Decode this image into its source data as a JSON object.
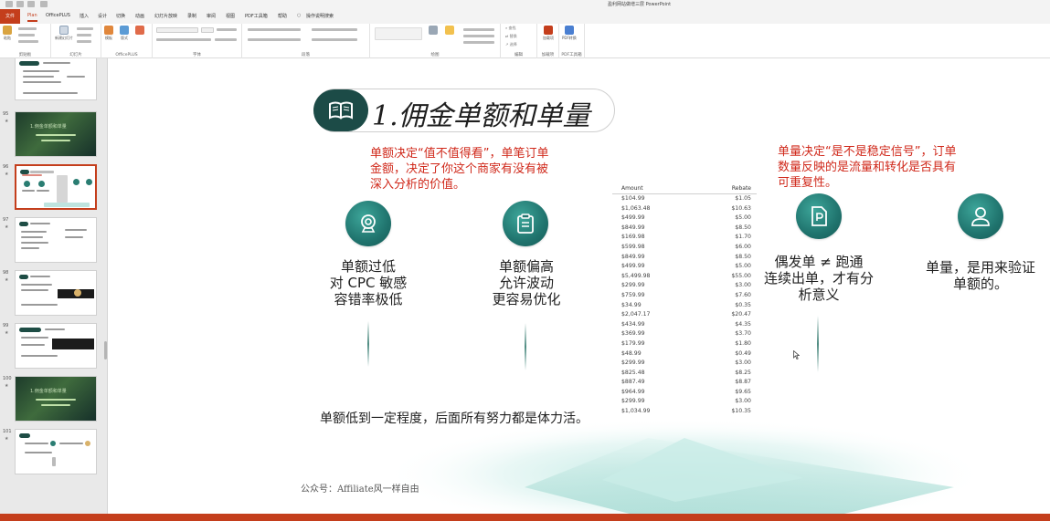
{
  "titlebar": {
    "document_title": "盈利网站做增三层    PowerPoint"
  },
  "ribbon": {
    "tabs": [
      {
        "label": "文件"
      },
      {
        "label": "Plan"
      },
      {
        "label": "OfficePLUS"
      },
      {
        "label": "插入"
      },
      {
        "label": "设计"
      },
      {
        "label": "切换"
      },
      {
        "label": "动画"
      },
      {
        "label": "幻灯片放映"
      },
      {
        "label": "录制"
      },
      {
        "label": "审阅"
      },
      {
        "label": "视图"
      },
      {
        "label": "PDF工具箱"
      },
      {
        "label": "帮助"
      },
      {
        "label": "操作说明搜索"
      }
    ],
    "groups": [
      {
        "label": "剪贴板"
      },
      {
        "label": "幻灯片"
      },
      {
        "label": "OfficePLUS"
      },
      {
        "label": "字体"
      },
      {
        "label": "段落"
      },
      {
        "label": "绘图"
      },
      {
        "label": "编辑"
      },
      {
        "label": "加载项"
      },
      {
        "label": "PDF工具箱"
      }
    ],
    "buttons": {
      "paste": "粘贴",
      "new_slide": "新建幻灯片",
      "template": "模板",
      "layout": "版式",
      "font_name": "",
      "find": "查找",
      "replace": "替换",
      "select": "选择",
      "addins": "加载项",
      "pdf_convert": "PDF转换"
    }
  },
  "thumbnails": [
    {
      "number": "",
      "starred": false
    },
    {
      "number": "95",
      "starred": true,
      "text": "1.佣金单额和单量"
    },
    {
      "number": "96",
      "starred": true,
      "selected": true
    },
    {
      "number": "97",
      "starred": true
    },
    {
      "number": "98",
      "starred": true
    },
    {
      "number": "99",
      "starred": true
    },
    {
      "number": "100",
      "starred": true,
      "text": "1.佣金单额和单量"
    },
    {
      "number": "101",
      "starred": true
    }
  ],
  "slide": {
    "title": "1.佣金单额和单量",
    "left_note": [
      "单额决定“值不值得看”，单笔订单",
      "金额，决定了你这个商家有没有被",
      "深入分析的价值。"
    ],
    "right_note": [
      "单量决定“是不是稳定信号”，订单",
      "数量反映的是流量和转化是否具有",
      "可重复性。"
    ],
    "col1": [
      "单额过低",
      "对 CPC 敏感",
      "容错率极低"
    ],
    "col2": [
      "单额偏高",
      "允许波动",
      "更容易优化"
    ],
    "col3": [
      "偶发单 ≠ 跑通",
      "连续出单，才有分",
      "析意义"
    ],
    "col4": [
      "单量，是用来验证",
      "单额的。"
    ],
    "bottom_text": "单额低到一定程度，后面所有努力都是体力活。",
    "footer": "公众号：Affiliate风一样自由",
    "icons": [
      "webcam-icon",
      "clipboard-icon",
      "document-p-icon",
      "user-icon"
    ]
  },
  "table": {
    "headers": [
      "Amount",
      "Rebate"
    ],
    "rows": [
      [
        "$104.99",
        "$1.05"
      ],
      [
        "$1,063.48",
        "$10.63"
      ],
      [
        "$499.99",
        "$5.00"
      ],
      [
        "$849.99",
        "$8.50"
      ],
      [
        "$169.98",
        "$1.70"
      ],
      [
        "$599.98",
        "$6.00"
      ],
      [
        "$849.99",
        "$8.50"
      ],
      [
        "$499.99",
        "$5.00"
      ],
      [
        "$5,499.98",
        "$55.00"
      ],
      [
        "$299.99",
        "$3.00"
      ],
      [
        "$759.99",
        "$7.60"
      ],
      [
        "$34.99",
        "$0.35"
      ],
      [
        "$2,047.17",
        "$20.47"
      ],
      [
        "$434.99",
        "$4.35"
      ],
      [
        "$369.99",
        "$3.70"
      ],
      [
        "$179.99",
        "$1.80"
      ],
      [
        "$48.99",
        "$0.49"
      ],
      [
        "$299.99",
        "$3.00"
      ],
      [
        "$825.48",
        "$8.25"
      ],
      [
        "$887.49",
        "$8.87"
      ],
      [
        "$964.99",
        "$9.65"
      ],
      [
        "$299.99",
        "$3.00"
      ],
      [
        "$1,034.99",
        "$10.35"
      ]
    ]
  },
  "colors": {
    "accent": "#c43e1c",
    "teal": "#20746e",
    "dark_teal": "#1c4b47",
    "note_red": "#d0291b"
  }
}
